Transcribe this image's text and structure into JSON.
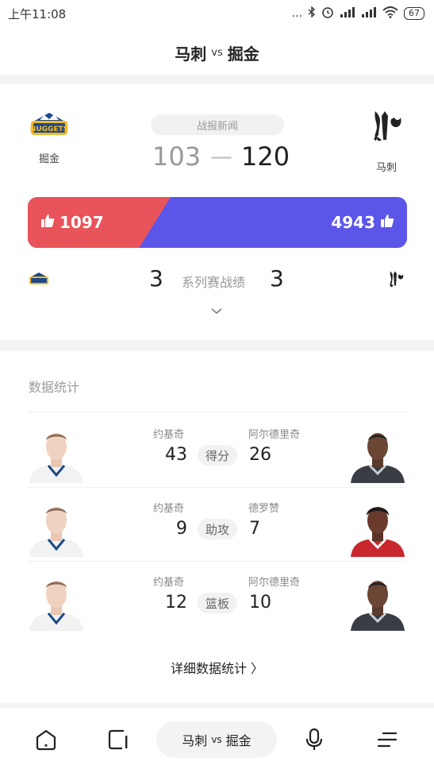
{
  "status": {
    "time": "上午11:08",
    "dots": "...",
    "battery": "67"
  },
  "header": {
    "team_a": "马刺",
    "vs": "vs",
    "team_b": "掘金"
  },
  "match": {
    "news_label": "战报新闻",
    "left_team": {
      "name": "掘金",
      "score": "103",
      "logo": "nuggets-logo"
    },
    "right_team": {
      "name": "马刺",
      "score": "120",
      "logo": "spurs-logo"
    },
    "dash": "—",
    "votes_left": "1097",
    "votes_right": "4943",
    "series": {
      "left": "3",
      "label": "系列赛战绩",
      "right": "3"
    },
    "expand_icon": "chevron-down-icon"
  },
  "stats": {
    "title": "数据统计",
    "rows": [
      {
        "left_name": "约基奇",
        "left_value": "43",
        "category": "得分",
        "right_name": "阿尔德里奇",
        "right_value": "26"
      },
      {
        "left_name": "约基奇",
        "left_value": "9",
        "category": "助攻",
        "right_name": "德罗赞",
        "right_value": "7"
      },
      {
        "left_name": "约基奇",
        "left_value": "12",
        "category": "篮板",
        "right_name": "阿尔德里奇",
        "right_value": "10"
      }
    ],
    "detail_link": "详细数据统计 〉"
  },
  "bottom_nav": {
    "pill_a": "马刺",
    "pill_vs": "vs",
    "pill_b": "掘金"
  },
  "colors": {
    "red": "#e9535a",
    "blue": "#5b55e8"
  }
}
